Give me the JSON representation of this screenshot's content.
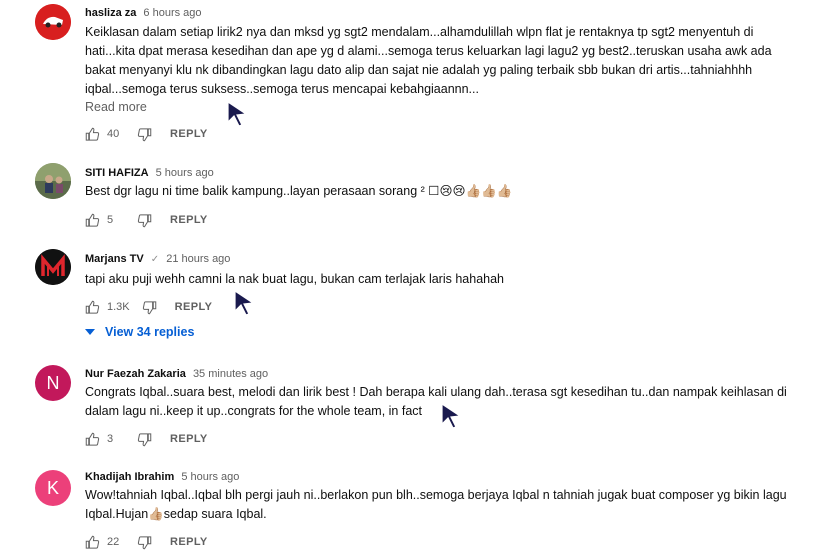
{
  "comments": [
    {
      "author": "hasliza za",
      "time": "6 hours ago",
      "text": "Keiklasan dalam setiap lirik2 nya dan mksd yg sgt2 mendalam...alhamdulillah wlpn flat je rentaknya tp sgt2 menyentuh di hati...kita dpat merasa kesedihan dan ape yg d alami...semoga terus keluarkan lagi lagu2 yg best2..teruskan usaha awk ada bakat menyanyi klu nk dibandingkan lagu dato alip dan sajat nie adalah yg paling terbaik sbb bukan dri artis...tahniahhhh iqbal...semoga terus suksess..semoga terus mencapai kebahgiaannn...",
      "read_more": "Read more",
      "likes": "40",
      "reply": "REPLY",
      "avatar_color": "#d81f1f"
    },
    {
      "author": "SITI HAFIZA",
      "time": "5 hours ago",
      "text": "Best dgr lagu ni time balik  kampung..layan perasaan sorang ² ☐😢😢👍🏼👍🏼👍🏼",
      "likes": "5",
      "reply": "REPLY",
      "avatar_color": "#7b8a6a"
    },
    {
      "author": "Marjans TV",
      "verified": "✓",
      "time": "21 hours ago",
      "text": "tapi aku puji wehh camni la nak buat lagu, bukan cam terlajak laris hahahah",
      "likes": "1.3K",
      "reply": "REPLY",
      "view_replies": "View 34 replies",
      "avatar_color": "#111111"
    },
    {
      "author": "Nur Faezah Zakaria",
      "time": "35 minutes ago",
      "text": "Congrats Iqbal..suara best, melodi dan lirik best ! Dah berapa kali ulang dah..terasa sgt kesedihan tu..dan nampak keihlasan di dalam lagu ni..keep it up..congrats for the whole team, in fact",
      "likes": "3",
      "reply": "REPLY",
      "avatar_letter": "N",
      "avatar_color": "#c2185b"
    },
    {
      "author": "Khadijah Ibrahim",
      "time": "5 hours ago",
      "text": "Wow!tahniah Iqbal..Iqbal blh pergi jauh ni..berlakon pun blh..semoga berjaya Iqbal n tahniah jugak buat composer yg bikin lagu Iqbal.Hujan👍🏼sedap suara Iqbal.",
      "likes": "22",
      "reply": "REPLY",
      "avatar_letter": "K",
      "avatar_color": "#ec407a"
    }
  ],
  "colors": {
    "link": "#065fd4",
    "secondary": "#606060"
  }
}
